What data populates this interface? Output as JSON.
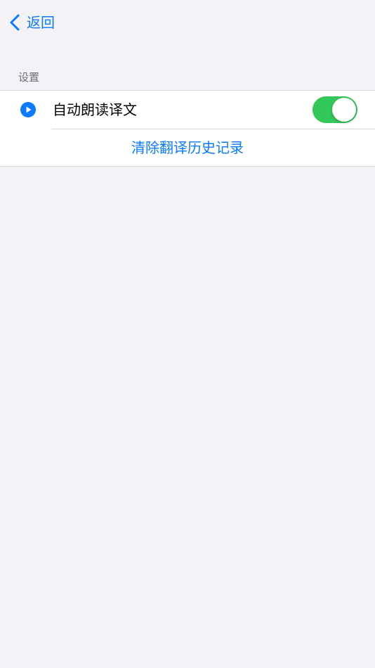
{
  "nav": {
    "back_label": "返回",
    "back_icon": "chevron-left-icon"
  },
  "settings": {
    "section_title": "设置",
    "auto_speak": {
      "icon": "play-circle-icon",
      "label": "自动朗读译文",
      "enabled": true
    },
    "clear_history_label": "清除翻译历史记录"
  },
  "colors": {
    "accent": "#0a7aff",
    "toggle_on": "#34c759",
    "background": "#f2f2f7"
  }
}
